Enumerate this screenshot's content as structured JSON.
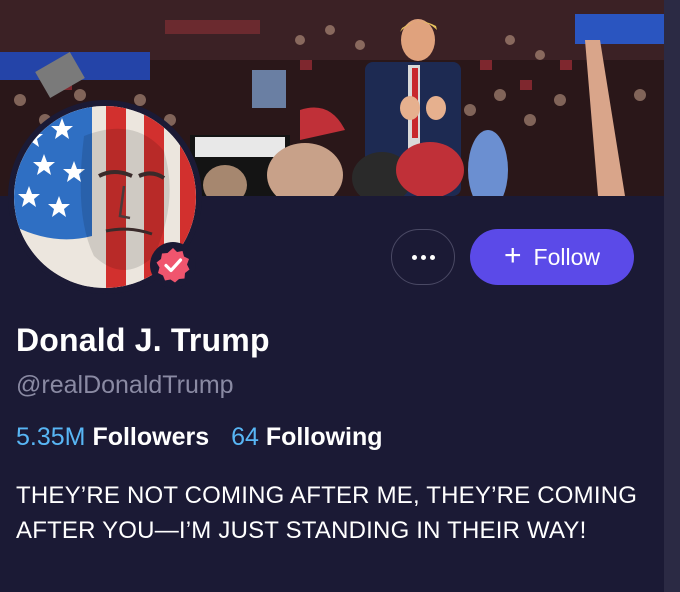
{
  "profile": {
    "name": "Donald J. Trump",
    "handle": "@realDonaldTrump",
    "followers_count": "5.35M",
    "followers_label": "Followers",
    "following_count": "64",
    "following_label": "Following",
    "bio": "THEY’RE NOT COMING AFTER ME, THEY’RE COMING AFTER YOU—I’M JUST STANDING IN THEIR WAY!"
  },
  "actions": {
    "follow_label": "Follow",
    "follow_icon": "plus-icon",
    "more_icon": "more-dots-icon"
  },
  "colors": {
    "background": "#1b1a35",
    "accent": "#5b4ae8",
    "stat_number": "#58b6f5",
    "verified": "#f0556e"
  }
}
